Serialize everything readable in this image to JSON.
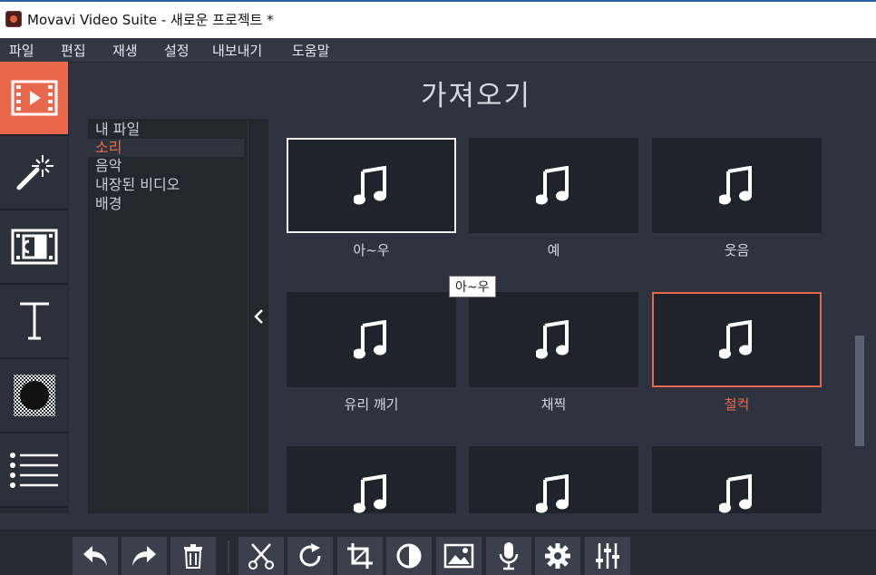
{
  "window": {
    "title": "Movavi Video Suite - 새로운 프로젝트 *"
  },
  "menu": {
    "items": [
      "파일",
      "편집",
      "재생",
      "설정",
      "내보내기",
      "도움말"
    ]
  },
  "left_tools": [
    {
      "icon": "import-media-icon",
      "active": true
    },
    {
      "icon": "magic-wand-icon",
      "active": false
    },
    {
      "icon": "transitions-icon",
      "active": false
    },
    {
      "icon": "text-titles-icon",
      "active": false
    },
    {
      "icon": "filters-icon",
      "active": false
    },
    {
      "icon": "more-tools-icon",
      "active": false
    }
  ],
  "main": {
    "heading": "가져오기",
    "categories": [
      "내 파일",
      "소리",
      "음악",
      "내장된 비디오",
      "배경"
    ],
    "selected_category": "소리",
    "items": [
      "아~우",
      "예",
      "웃음",
      "유리 깨기",
      "채찍",
      "철컥",
      "",
      "",
      ""
    ],
    "hovered_item": "아~우",
    "selected_item": "철컥",
    "tooltip": "아~우"
  },
  "bottom_tools": [
    "undo-icon",
    "redo-icon",
    "delete-icon",
    "cut-icon",
    "rotate-icon",
    "crop-icon",
    "color-adjust-icon",
    "picture-icon",
    "microphone-icon",
    "settings-icon",
    "equalizer-icon"
  ],
  "colors": {
    "accent": "#e9674a",
    "background": "#2d3440",
    "panel": "#23282f",
    "card": "#1f232b"
  }
}
